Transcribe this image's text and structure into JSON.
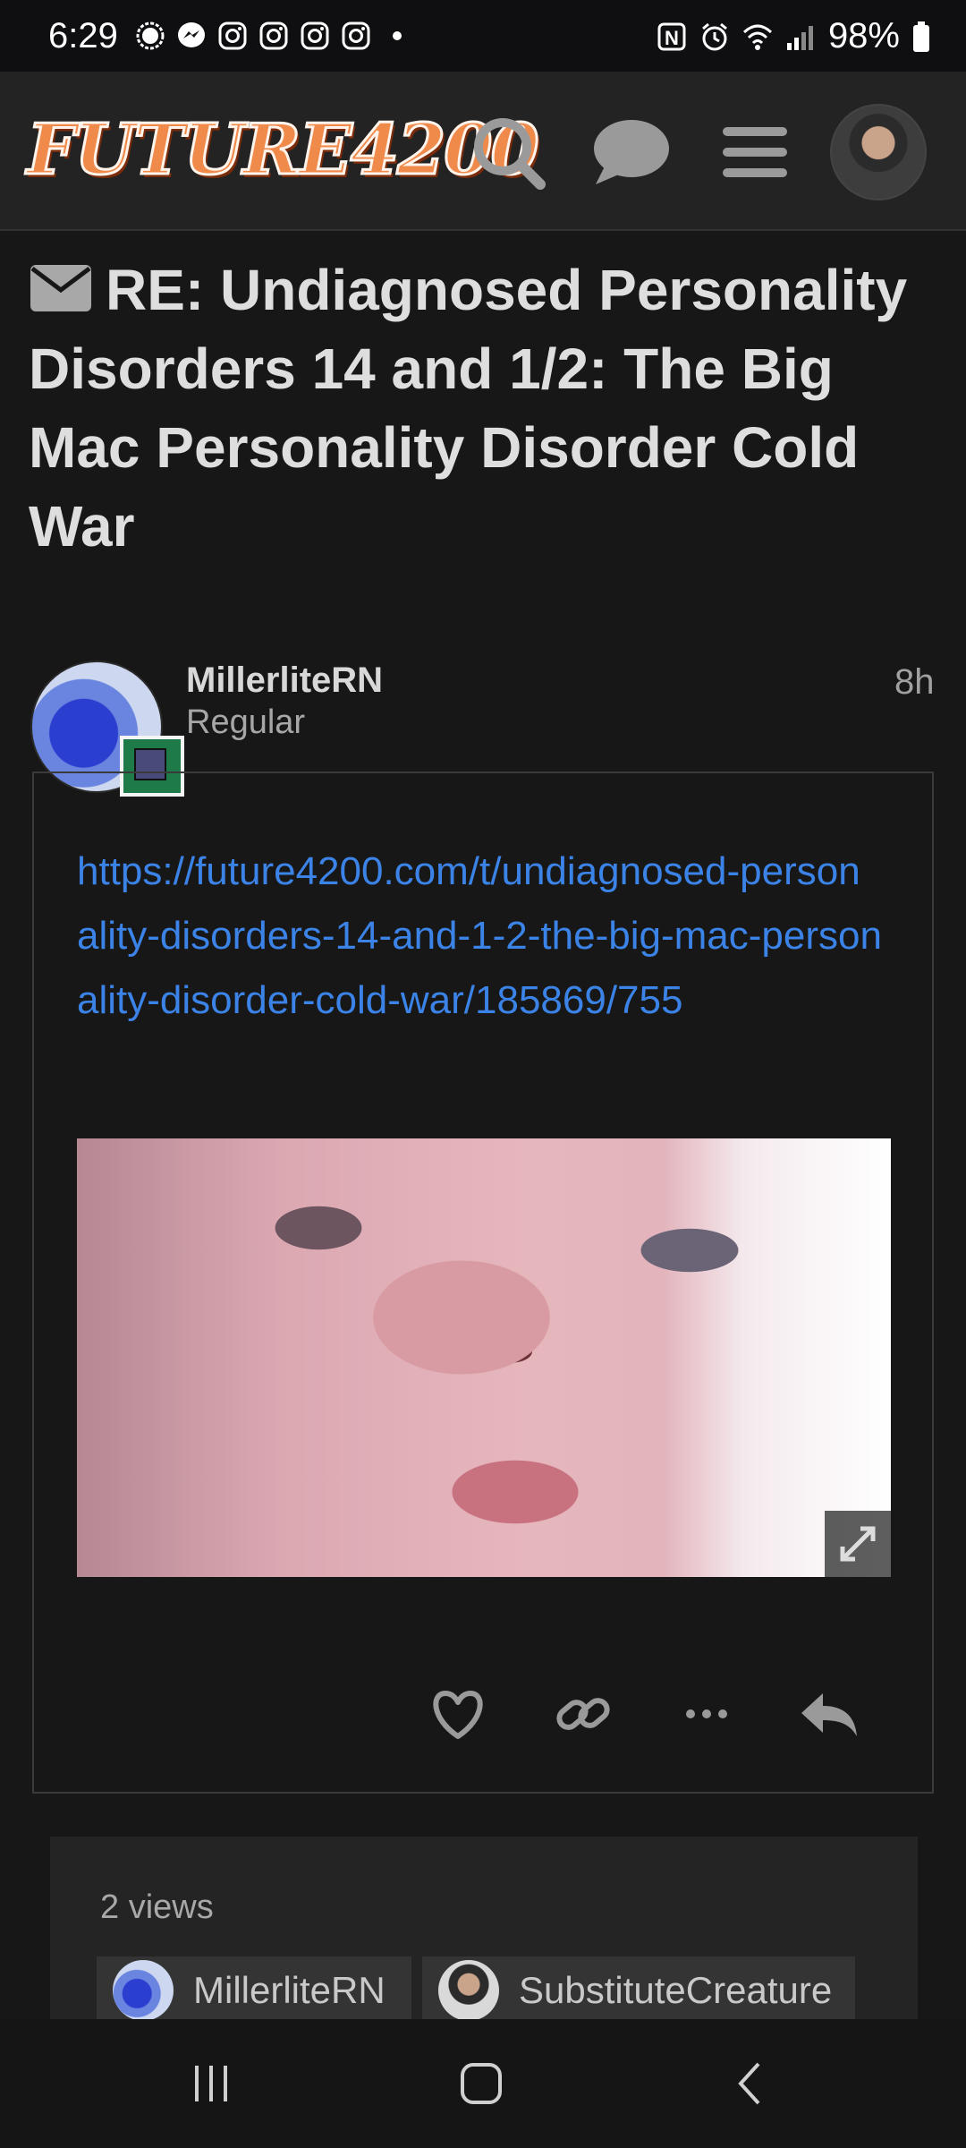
{
  "status_bar": {
    "time": "6:29",
    "battery": "98%",
    "notification_icons": [
      "signal-app-icon",
      "messenger-icon",
      "instagram-icon",
      "instagram-icon",
      "instagram-icon",
      "instagram-icon",
      "more-dot-icon"
    ],
    "status_icons": [
      "nfc-icon",
      "alarm-icon",
      "wifi-icon",
      "cellular-signal-icon",
      "battery-icon"
    ]
  },
  "header": {
    "logo_text": "FUTURE4200",
    "icons": [
      "search-icon",
      "chat-bubble-icon",
      "hamburger-menu-icon",
      "user-avatar"
    ]
  },
  "topic": {
    "title": "RE: Undiagnosed Personality Disorders 14 and 1/2: The Big Mac Personality Disorder Cold War",
    "title_icon": "envelope-icon"
  },
  "post": {
    "username": "MillerliteRN",
    "user_title": "Regular",
    "age": "8h",
    "link": "https://future4200.com/t/undiagnosed-personality-disorders-14-and-1-2-the-big-mac-personality-disorder-cold-war/185869/755",
    "actions": [
      "heart-icon",
      "link-icon",
      "more-icon",
      "reply-icon"
    ]
  },
  "summary": {
    "views": "2 views",
    "participants": [
      {
        "name": "MillerliteRN"
      },
      {
        "name": "SubstituteCreature"
      }
    ]
  },
  "navbar": {
    "icons": [
      "recent-apps-icon",
      "home-icon",
      "back-icon"
    ]
  },
  "colors": {
    "background": "#171717",
    "header": "#232323",
    "link": "#3b83e6",
    "text": "#dddddd",
    "muted": "#a8a8a8"
  }
}
